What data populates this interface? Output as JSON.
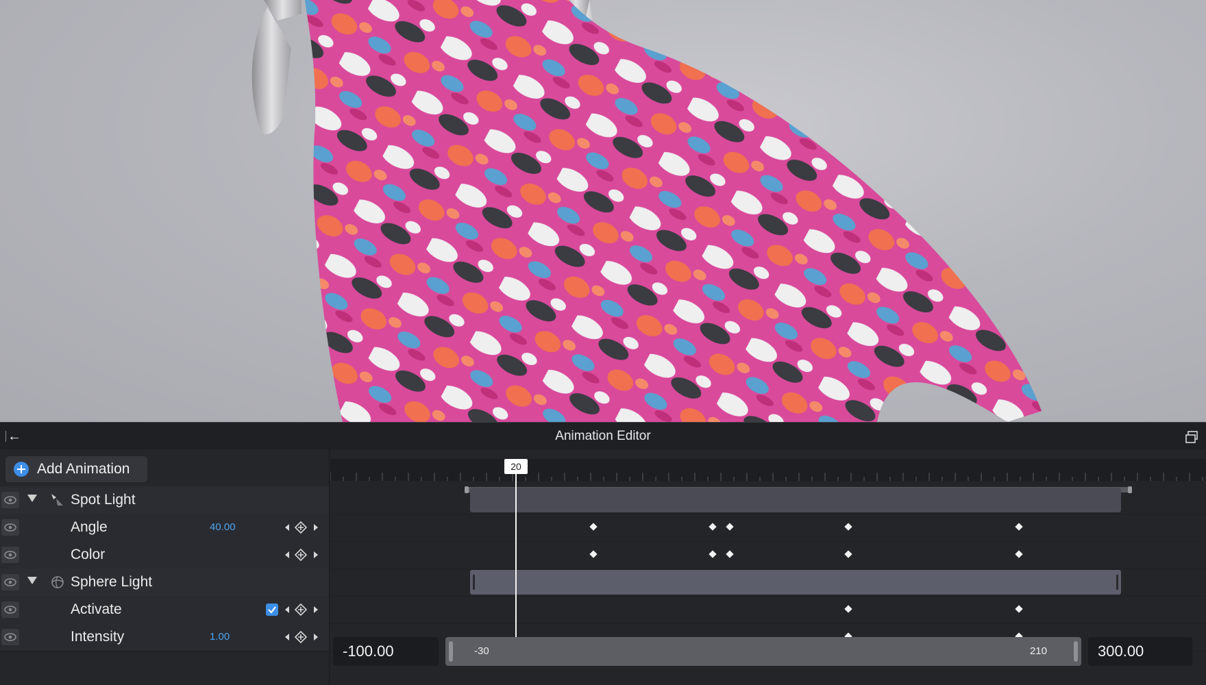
{
  "editor": {
    "title": "Animation Editor",
    "add_animation_label": "Add Animation",
    "tracks": [
      {
        "name": "Spot Light",
        "value": "",
        "kind": "group"
      },
      {
        "name": "Angle",
        "value": "40.00",
        "kind": "prop"
      },
      {
        "name": "Color",
        "value": "",
        "kind": "prop"
      },
      {
        "name": "Sphere Light",
        "value": "",
        "kind": "group"
      },
      {
        "name": "Activate",
        "value": "",
        "kind": "prop",
        "checked": true
      },
      {
        "name": "Intensity",
        "value": "1.00",
        "kind": "prop"
      }
    ]
  },
  "timeline": {
    "playhead_frame": "20",
    "range_start_field": "-100.00",
    "range_end_field": "300.00",
    "scroll_start_label": "-30",
    "scroll_end_label": "210"
  },
  "colors": {
    "accent": "#3d8ee6",
    "value_text": "#4aa3f0"
  }
}
